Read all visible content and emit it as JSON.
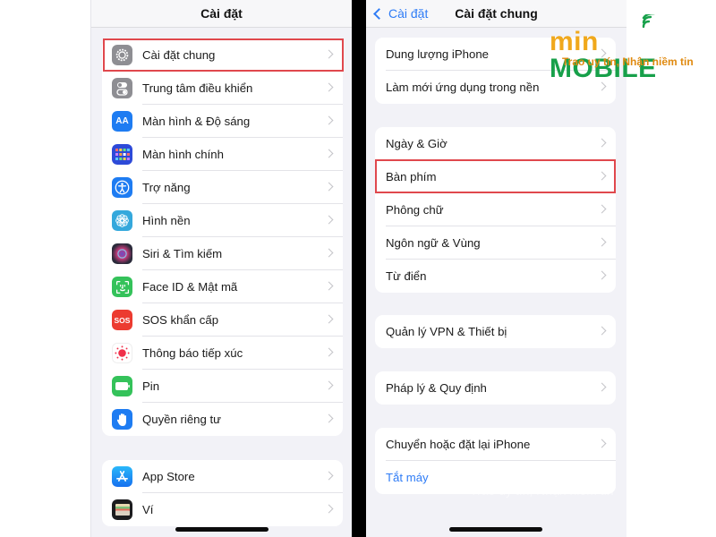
{
  "left_screen": {
    "title": "Cài đặt",
    "groups": [
      {
        "items": [
          {
            "label": "Cài đặt chung",
            "icon": "gear-icon",
            "icon_color": "#8e8e93",
            "highlighted": true
          },
          {
            "label": "Trung tâm điều khiển",
            "icon": "control-center-icon",
            "icon_color": "#8e8e93"
          },
          {
            "label": "Màn hình & Độ sáng",
            "icon": "display-brightness-icon",
            "icon_color": "#1e7cf2",
            "icon_text": "AA"
          },
          {
            "label": "Màn hình chính",
            "icon": "home-screen-icon",
            "icon_color": "#2d4ad8"
          },
          {
            "label": "Trợ năng",
            "icon": "accessibility-icon",
            "icon_color": "#1e7cf2"
          },
          {
            "label": "Hình nền",
            "icon": "wallpaper-icon",
            "icon_color": "#34a8dc"
          },
          {
            "label": "Siri & Tìm kiếm",
            "icon": "siri-icon",
            "icon_color": "#2a2a3a"
          },
          {
            "label": "Face ID & Mật mã",
            "icon": "face-id-icon",
            "icon_color": "#34c25a"
          },
          {
            "label": "SOS khẩn cấp",
            "icon": "sos-icon",
            "icon_color": "#ec3b30",
            "icon_text": "SOS"
          },
          {
            "label": "Thông báo tiếp xúc",
            "icon": "exposure-notification-icon",
            "icon_color": "#ffffff"
          },
          {
            "label": "Pin",
            "icon": "battery-icon",
            "icon_color": "#34c25a"
          },
          {
            "label": "Quyền riêng tư",
            "icon": "privacy-hand-icon",
            "icon_color": "#1e7cf2"
          }
        ]
      },
      {
        "items": [
          {
            "label": "App Store",
            "icon": "app-store-icon",
            "icon_color": "#1e8cf5"
          },
          {
            "label": "Ví",
            "icon": "wallet-icon",
            "icon_color": "#1c1c1e"
          }
        ]
      }
    ]
  },
  "right_screen": {
    "back_label": "Cài đặt",
    "title": "Cài đặt chung",
    "groups": [
      {
        "items": [
          {
            "label": "Dung lượng iPhone"
          },
          {
            "label": "Làm mới ứng dụng trong nền"
          }
        ]
      },
      {
        "items": [
          {
            "label": "Ngày & Giờ"
          },
          {
            "label": "Bàn phím",
            "highlighted": true
          },
          {
            "label": "Phông chữ"
          },
          {
            "label": "Ngôn ngữ & Vùng"
          },
          {
            "label": "Từ điển"
          }
        ]
      },
      {
        "items": [
          {
            "label": "Quản lý VPN & Thiết bị"
          }
        ]
      },
      {
        "items": [
          {
            "label": "Pháp lý & Quy định"
          }
        ]
      },
      {
        "items": [
          {
            "label": "Chuyển hoặc đặt lại iPhone"
          },
          {
            "label": "Tắt máy",
            "link": true
          }
        ]
      }
    ]
  },
  "brand": {
    "name_part1": "min",
    "name_part2": "MOBILE",
    "tagline": "Trao uy tín, Nhận niềm tin",
    "primary_color": "#f0a81c",
    "secondary_color": "#17a04a"
  },
  "colors": {
    "highlight_border": "#e0484d",
    "ios_blue": "#2f7cf6",
    "grouped_background": "#f2f2f7"
  }
}
